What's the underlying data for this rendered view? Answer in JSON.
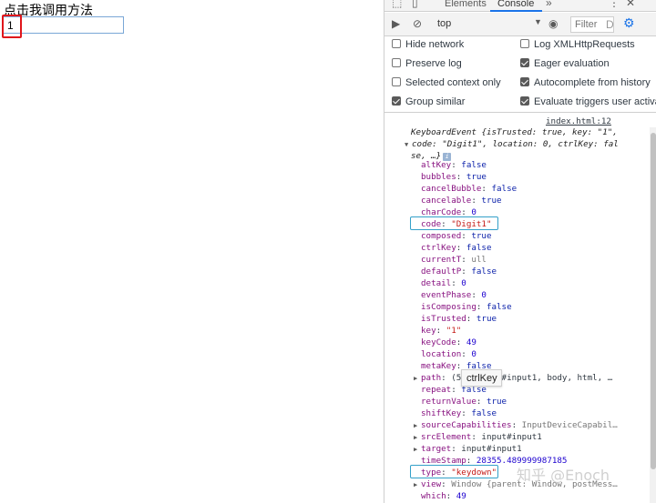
{
  "page": {
    "label": "点击我调用方法",
    "input_value": "1"
  },
  "devtools": {
    "tabs": [
      {
        "label": "Elements"
      },
      {
        "label": "Console"
      }
    ],
    "more_tabs": "»",
    "toolbar": {
      "context": "top",
      "filter_placeholder": "Filter",
      "filter_suffix": "D"
    },
    "settings": [
      {
        "label": "Hide network",
        "checked": false
      },
      {
        "label": "Log XMLHttpRequests",
        "checked": false
      },
      {
        "label": "Preserve log",
        "checked": false
      },
      {
        "label": "Eager evaluation",
        "checked": true
      },
      {
        "label": "Selected context only",
        "checked": false
      },
      {
        "label": "Autocomplete from history",
        "checked": true
      },
      {
        "label": "Group similar",
        "checked": true
      },
      {
        "label": "Evaluate triggers user activa",
        "checked": true
      }
    ],
    "console": {
      "source_link": "index.html:12",
      "summary_line1": "KeyboardEvent {isTrusted: true, key: \"1\",",
      "summary_line2": "code: \"Digit1\", location: 0, ctrlKey: fal",
      "summary_line3": "se, …}",
      "info_badge": "i",
      "properties": [
        {
          "key": "altKey",
          "value": "false",
          "kind": "bool"
        },
        {
          "key": "bubbles",
          "value": "true",
          "kind": "bool"
        },
        {
          "key": "cancelBubble",
          "value": "false",
          "kind": "bool"
        },
        {
          "key": "cancelable",
          "value": "true",
          "kind": "bool"
        },
        {
          "key": "charCode",
          "value": "0",
          "kind": "num"
        },
        {
          "key": "code",
          "value": "\"Digit1\"",
          "kind": "str"
        },
        {
          "key": "composed",
          "value": "true",
          "kind": "bool"
        },
        {
          "key": "ctrlKey",
          "value": "false",
          "kind": "bool"
        },
        {
          "key": "currentT",
          "value": "ull",
          "kind": "gray"
        },
        {
          "key": "defaultP",
          "value": "false",
          "kind": "bool"
        },
        {
          "key": "detail",
          "value": "0",
          "kind": "num"
        },
        {
          "key": "eventPhase",
          "value": "0",
          "kind": "num"
        },
        {
          "key": "isComposing",
          "value": "false",
          "kind": "bool"
        },
        {
          "key": "isTrusted",
          "value": "true",
          "kind": "bool"
        },
        {
          "key": "key",
          "value": "\"1\"",
          "kind": "str"
        },
        {
          "key": "keyCode",
          "value": "49",
          "kind": "num"
        },
        {
          "key": "location",
          "value": "0",
          "kind": "num"
        },
        {
          "key": "metaKey",
          "value": "false",
          "kind": "bool"
        },
        {
          "key": "path",
          "value": "(5) [input#input1, body, html, …",
          "kind": "obj",
          "expandable": true
        },
        {
          "key": "repeat",
          "value": "false",
          "kind": "bool"
        },
        {
          "key": "returnValue",
          "value": "true",
          "kind": "bool"
        },
        {
          "key": "shiftKey",
          "value": "false",
          "kind": "bool"
        },
        {
          "key": "sourceCapabilities",
          "value": "InputDeviceCapabil…",
          "kind": "gray",
          "expandable": true
        },
        {
          "key": "srcElement",
          "value": "input#input1",
          "kind": "obj",
          "expandable": true
        },
        {
          "key": "target",
          "value": "input#input1",
          "kind": "obj",
          "expandable": true
        },
        {
          "key": "timeStamp",
          "value": "28355.489999987185",
          "kind": "num"
        },
        {
          "key": "type",
          "value": "\"keydown\"",
          "kind": "str"
        },
        {
          "key": "view",
          "value": "Window {parent: Window, postMess…",
          "kind": "gray",
          "expandable": true
        },
        {
          "key": "which",
          "value": "49",
          "kind": "num"
        }
      ]
    },
    "tooltip": "ctrlKey"
  },
  "watermark": "知乎 @Enoch",
  "colors": {
    "accent": "#1a73e8",
    "highlight_red": "#e0161b",
    "highlight_blue": "#33a0c9"
  }
}
